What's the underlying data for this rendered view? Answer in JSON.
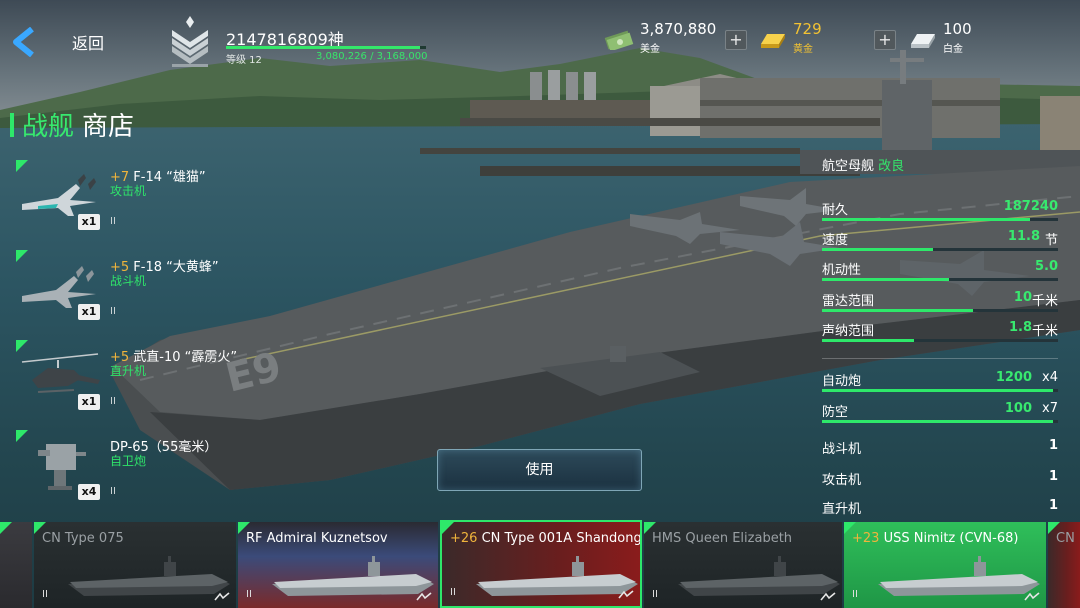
{
  "header": {
    "back_label": "返回",
    "player_name": "2147816809神",
    "level_label": "等级 12",
    "xp_text": "3,080,226 / 3,168,000",
    "xp_fraction": 0.972
  },
  "currencies": [
    {
      "amount": "3,870,880",
      "name": "美金",
      "color": "#ffffff",
      "name_color": "#ffffff",
      "icon": "dollar-bills-icon"
    },
    {
      "amount": "729",
      "name": "黄金",
      "color": "#f2c233",
      "name_color": "#f2c233",
      "icon": "gold-bar-icon"
    },
    {
      "amount": "100",
      "name": "白金",
      "color": "#ffffff",
      "name_color": "#ffffff",
      "icon": "platinum-bar-icon"
    }
  ],
  "shop": {
    "title_part1": "战舰",
    "title_part2": "商店"
  },
  "aircraft": [
    {
      "level": "+7",
      "name": " F-14 “雄猫”",
      "type": "攻击机",
      "count": "x1",
      "pause": "II",
      "icon": "f14-jet-icon"
    },
    {
      "level": "+5",
      "name": " F-18 “大黄蜂”",
      "type": "战斗机",
      "count": "x1",
      "pause": "II",
      "icon": "f18-jet-icon"
    },
    {
      "level": "+5",
      "name": " 武直-10 “霹雳火”",
      "type": "直升机",
      "count": "x1",
      "pause": "II",
      "icon": "helicopter-icon"
    },
    {
      "level": "",
      "name": "DP-65（55毫米）",
      "type": "自卫炮",
      "count": "x4",
      "pause": "II",
      "icon": "turret-gun-icon"
    }
  ],
  "use_button": "使用",
  "stats": {
    "title": "航空母舰 ",
    "title_mod": "改良",
    "rows": [
      {
        "name": "耐久",
        "value": "187240",
        "unit": "",
        "fill": 0.88
      },
      {
        "name": "速度",
        "value": "11.8",
        "unit": "节",
        "fill": 0.47
      },
      {
        "name": "机动性",
        "value": "5.0",
        "unit": "",
        "fill": 0.54
      },
      {
        "name": "雷达范围",
        "value": "10",
        "unit": "千米",
        "fill": 0.64
      },
      {
        "name": "声纳范围",
        "value": "1.8",
        "unit": "千米",
        "fill": 0.39
      },
      {
        "name": "自动炮",
        "value": "1200",
        "unit": "x4",
        "fill": 0.98
      },
      {
        "name": "防空",
        "value": "100",
        "unit": "x7",
        "fill": 0.98
      }
    ],
    "counts": [
      {
        "name": "战斗机",
        "value": "1"
      },
      {
        "name": "攻击机",
        "value": "1"
      },
      {
        "name": "直升机",
        "value": "1"
      }
    ]
  },
  "ships": [
    {
      "level": "",
      "name": "",
      "state": "partial-left",
      "flag": "none"
    },
    {
      "level": "",
      "name": "CN Type 075",
      "state": "locked",
      "flag": "china"
    },
    {
      "level": "",
      "name": "RF Admiral Kuznetsov",
      "state": "unlocked",
      "flag": "russia"
    },
    {
      "level": "+26",
      "name": " CN Type 001A Shandong",
      "state": "selected",
      "flag": "china"
    },
    {
      "level": "",
      "name": "HMS Queen Elizabeth",
      "state": "locked",
      "flag": "uk"
    },
    {
      "level": "+23",
      "name": " USS Nimitz (CVN-68)",
      "state": "owned-green",
      "flag": "usa"
    },
    {
      "level": "",
      "name": "CN",
      "state": "partial-right",
      "flag": "china"
    }
  ],
  "pause_glyph": "II",
  "colors": {
    "accent_green": "#2ee86a",
    "gold": "#f2c233",
    "level_orange": "#f0b43c"
  }
}
